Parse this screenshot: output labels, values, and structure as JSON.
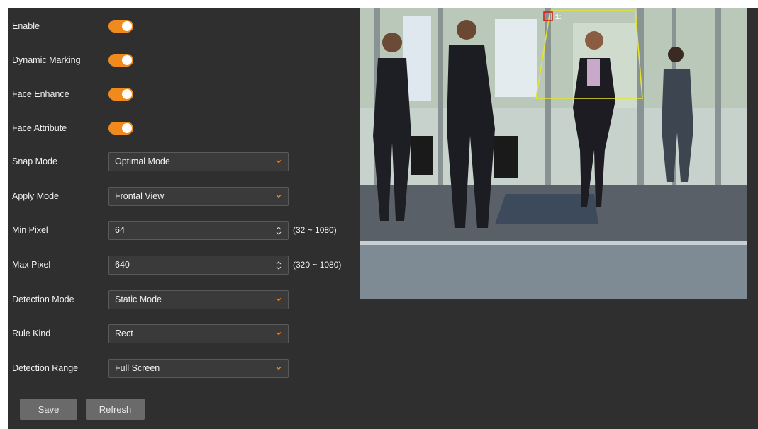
{
  "settings": {
    "enable": {
      "label": "Enable",
      "on": true
    },
    "dynamic_marking": {
      "label": "Dynamic Marking",
      "on": true
    },
    "face_enhance": {
      "label": "Face Enhance",
      "on": true
    },
    "face_attribute": {
      "label": "Face Attribute",
      "on": true
    },
    "snap_mode": {
      "label": "Snap Mode",
      "value": "Optimal Mode"
    },
    "apply_mode": {
      "label": "Apply Mode",
      "value": "Frontal View"
    },
    "min_pixel": {
      "label": "Min Pixel",
      "value": "64",
      "range": "(32 ~ 1080)"
    },
    "max_pixel": {
      "label": "Max Pixel",
      "value": "640",
      "range": "(320 ~ 1080)"
    },
    "detection_mode": {
      "label": "Detection Mode",
      "value": "Static Mode"
    },
    "rule_kind": {
      "label": "Rule Kind",
      "value": "Rect"
    },
    "detection_range": {
      "label": "Detection Range",
      "value": "Full Screen"
    }
  },
  "buttons": {
    "save": "Save",
    "refresh": "Refresh"
  },
  "preview": {
    "region_label": "1:"
  },
  "colors": {
    "accent": "#f18a1c",
    "panel": "#2f2f2f",
    "region": "#e6e62a",
    "marker": "#d02020"
  }
}
